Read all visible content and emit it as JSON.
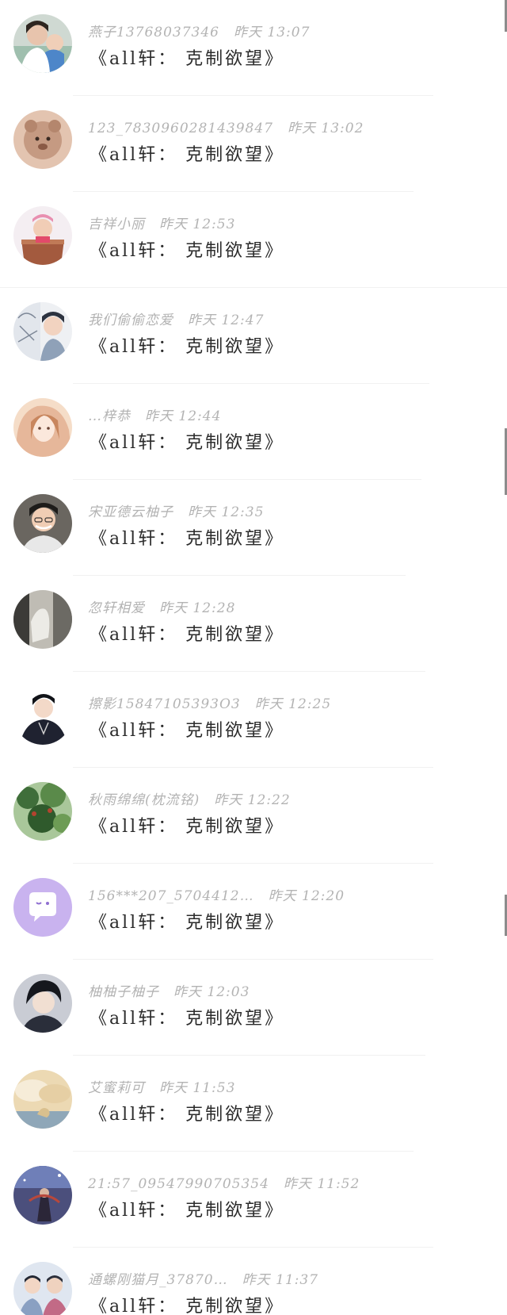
{
  "message_text": "《all轩： 克制欲望》",
  "items": [
    {
      "name": "燕子13768037346",
      "time": "昨天 13:07",
      "avatar": "photo-mother-child",
      "avatar_color": "#9fbfae"
    },
    {
      "name": "123_7830960281439847",
      "time": "昨天 13:02",
      "avatar": "cartoon-cookie-animal",
      "avatar_color": "#c59a82"
    },
    {
      "name": "吉祥小丽",
      "time": "昨天 12:53",
      "avatar": "photo-baby-in-basket",
      "avatar_color": "#a35a3e"
    },
    {
      "name": "我们偷偷恋爱",
      "time": "昨天 12:47",
      "avatar": "sketch-and-photo-boy",
      "avatar_color": "#8fa1b8"
    },
    {
      "name": "…梓恭",
      "time": "昨天 12:44",
      "avatar": "anime-girl",
      "avatar_color": "#e6b79a"
    },
    {
      "name": "宋亚德云柚子",
      "time": "昨天 12:35",
      "avatar": "photo-boy-smiling",
      "avatar_color": "#3d3a37"
    },
    {
      "name": "忽轩相爱",
      "time": "昨天 12:28",
      "avatar": "photo-dim-room",
      "avatar_color": "#6c6a64"
    },
    {
      "name": "擦影15847105393O3",
      "time": "昨天 12:25",
      "avatar": "photo-boy-dark",
      "avatar_color": "#1f2230"
    },
    {
      "name": "秋雨绵绵(枕流铭)",
      "time": "昨天 12:22",
      "avatar": "photo-green-leaves",
      "avatar_color": "#3f6e3a"
    },
    {
      "name": "156***207_5704412…",
      "time": "昨天 12:20",
      "avatar": "default-chat-bubble",
      "avatar_color": "#c9b3ef"
    },
    {
      "name": "柚柚子柚子",
      "time": "昨天 12:03",
      "avatar": "photo-boy-black-hair",
      "avatar_color": "#2a2e3a"
    },
    {
      "name": "艾蜜莉可",
      "time": "昨天 11:53",
      "avatar": "photo-cloud-sky",
      "avatar_color": "#d9c08e"
    },
    {
      "name": "21:57_09547990705354",
      "time": "昨天 11:52",
      "avatar": "art-night-sky-figure",
      "avatar_color": "#4b4f7c"
    },
    {
      "name": "通螺刚猫月_37870…",
      "time": "昨天 11:37",
      "avatar": "photo-two-boys",
      "avatar_color": "#8aa0c2"
    }
  ],
  "scrollbar_color": "#8c8c8c"
}
